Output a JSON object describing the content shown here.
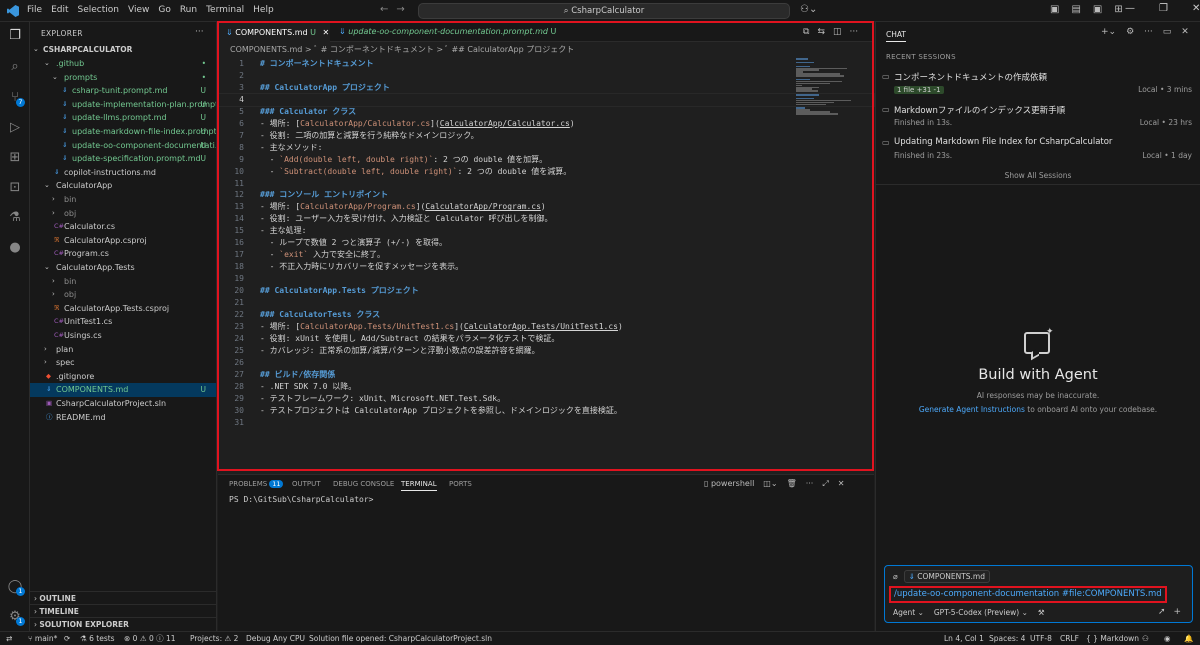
{
  "titlebar": {
    "menu": [
      "File",
      "Edit",
      "Selection",
      "View",
      "Go",
      "Run",
      "Terminal",
      "Help"
    ],
    "search": "CsharpCalculator"
  },
  "activity_badges": {
    "source_control": "7",
    "accounts": "1",
    "settings": "1"
  },
  "explorer": {
    "header": "EXPLORER",
    "root": "CSHARPCALCULATOR",
    "items": [
      {
        "label": ".github",
        "depth": 1,
        "type": "folder-open",
        "status": "•",
        "color": "#73c991"
      },
      {
        "label": "prompts",
        "depth": 2,
        "type": "folder-open",
        "status": "•",
        "color": "#73c991"
      },
      {
        "label": "csharp-tunit.prompt.md",
        "depth": 3,
        "type": "md",
        "status": "U",
        "color": "#73c991"
      },
      {
        "label": "update-implementation-plan.prompt....",
        "depth": 3,
        "type": "md",
        "status": "U",
        "color": "#73c991"
      },
      {
        "label": "update-llms.prompt.md",
        "depth": 3,
        "type": "md",
        "status": "U",
        "color": "#73c991"
      },
      {
        "label": "update-markdown-file-index.prompt....",
        "depth": 3,
        "type": "md",
        "status": "U",
        "color": "#73c991"
      },
      {
        "label": "update-oo-component-documentati...",
        "depth": 3,
        "type": "md",
        "status": "U",
        "color": "#73c991"
      },
      {
        "label": "update-specification.prompt.md",
        "depth": 3,
        "type": "md",
        "status": "U",
        "color": "#73c991"
      },
      {
        "label": "copilot-instructions.md",
        "depth": 2,
        "type": "md",
        "status": "",
        "color": "#cccccc"
      },
      {
        "label": "CalculatorApp",
        "depth": 1,
        "type": "folder-open",
        "status": "",
        "color": "#cccccc"
      },
      {
        "label": "bin",
        "depth": 2,
        "type": "folder",
        "status": "",
        "color": "#8c8c8c"
      },
      {
        "label": "obj",
        "depth": 2,
        "type": "folder",
        "status": "",
        "color": "#8c8c8c"
      },
      {
        "label": "Calculator.cs",
        "depth": 2,
        "type": "cs",
        "status": "",
        "color": "#cccccc"
      },
      {
        "label": "CalculatorApp.csproj",
        "depth": 2,
        "type": "proj",
        "status": "",
        "color": "#cccccc"
      },
      {
        "label": "Program.cs",
        "depth": 2,
        "type": "cs",
        "status": "",
        "color": "#cccccc"
      },
      {
        "label": "CalculatorApp.Tests",
        "depth": 1,
        "type": "folder-open",
        "status": "",
        "color": "#cccccc"
      },
      {
        "label": "bin",
        "depth": 2,
        "type": "folder",
        "status": "",
        "color": "#8c8c8c"
      },
      {
        "label": "obj",
        "depth": 2,
        "type": "folder",
        "status": "",
        "color": "#8c8c8c"
      },
      {
        "label": "CalculatorApp.Tests.csproj",
        "depth": 2,
        "type": "proj",
        "status": "",
        "color": "#cccccc"
      },
      {
        "label": "UnitTest1.cs",
        "depth": 2,
        "type": "cs",
        "status": "",
        "color": "#cccccc"
      },
      {
        "label": "Usings.cs",
        "depth": 2,
        "type": "cs",
        "status": "",
        "color": "#cccccc"
      },
      {
        "label": "plan",
        "depth": 1,
        "type": "folder",
        "status": "",
        "color": "#cccccc"
      },
      {
        "label": "spec",
        "depth": 1,
        "type": "folder",
        "status": "",
        "color": "#cccccc"
      },
      {
        "label": ".gitignore",
        "depth": 1,
        "type": "git",
        "status": "",
        "color": "#cccccc"
      },
      {
        "label": "COMPONENTS.md",
        "depth": 1,
        "type": "md",
        "status": "U",
        "color": "#73c991",
        "selected": true
      },
      {
        "label": "CsharpCalculatorProject.sln",
        "depth": 1,
        "type": "sln",
        "status": "",
        "color": "#cccccc"
      },
      {
        "label": "README.md",
        "depth": 1,
        "type": "md-info",
        "status": "",
        "color": "#cccccc"
      }
    ],
    "panels": [
      "OUTLINE",
      "TIMELINE",
      "SOLUTION EXPLORER"
    ]
  },
  "editor": {
    "tabs": [
      {
        "label": "COMPONENTS.md",
        "status": "U",
        "active": true
      },
      {
        "label": "update-oo-component-documentation.prompt.md",
        "status": "U",
        "active": false
      }
    ],
    "breadcrumb": "COMPONENTS.md  >  ﾞ # コンポーネントドキュメント  >  ﾞ ## CalculatorApp プロジェクト",
    "lines": [
      {
        "n": "1",
        "text": "# コンポーネントドキュメント",
        "kind": "h"
      },
      {
        "n": "2",
        "text": "",
        "kind": "t"
      },
      {
        "n": "3",
        "text": "## CalculatorApp プロジェクト",
        "kind": "h"
      },
      {
        "n": "4",
        "text": "",
        "kind": "t"
      },
      {
        "n": "5",
        "text": "### Calculator クラス",
        "kind": "h"
      },
      {
        "n": "6",
        "text": "- 場所: [CalculatorApp/Calculator.cs](CalculatorApp/Calculator.cs)",
        "kind": "link"
      },
      {
        "n": "7",
        "text": "- 役割: 二項の加算と減算を行う純粋なドメインロジック。",
        "kind": "t"
      },
      {
        "n": "8",
        "text": "- 主なメソッド:",
        "kind": "t"
      },
      {
        "n": "9",
        "text": "  - `Add(double left, double right)`: 2 つの double 値を加算。",
        "kind": "code"
      },
      {
        "n": "10",
        "text": "  - `Subtract(double left, double right)`: 2 つの double 値を減算。",
        "kind": "code"
      },
      {
        "n": "11",
        "text": "",
        "kind": "t"
      },
      {
        "n": "12",
        "text": "### コンソール エントリポイント",
        "kind": "h"
      },
      {
        "n": "13",
        "text": "- 場所: [CalculatorApp/Program.cs](CalculatorApp/Program.cs)",
        "kind": "link"
      },
      {
        "n": "14",
        "text": "- 役割: ユーザー入力を受け付け、入力検証と Calculator 呼び出しを制御。",
        "kind": "t"
      },
      {
        "n": "15",
        "text": "- 主な処理:",
        "kind": "t"
      },
      {
        "n": "16",
        "text": "  - ループで数値 2 つと演算子 (+/-) を取得。",
        "kind": "t"
      },
      {
        "n": "17",
        "text": "  - `exit` 入力で安全に終了。",
        "kind": "code"
      },
      {
        "n": "18",
        "text": "  - 不正入力時にリカバリーを促すメッセージを表示。",
        "kind": "t"
      },
      {
        "n": "19",
        "text": "",
        "kind": "t"
      },
      {
        "n": "20",
        "text": "## CalculatorApp.Tests プロジェクト",
        "kind": "h"
      },
      {
        "n": "21",
        "text": "",
        "kind": "t"
      },
      {
        "n": "22",
        "text": "### CalculatorTests クラス",
        "kind": "h"
      },
      {
        "n": "23",
        "text": "- 場所: [CalculatorApp.Tests/UnitTest1.cs](CalculatorApp.Tests/UnitTest1.cs)",
        "kind": "link"
      },
      {
        "n": "24",
        "text": "- 役割: xUnit を使用し Add/Subtract の結果をパラメータ化テストで検証。",
        "kind": "t"
      },
      {
        "n": "25",
        "text": "- カバレッジ: 正常系の加算/減算パターンと浮動小数点の誤差許容を網羅。",
        "kind": "t"
      },
      {
        "n": "26",
        "text": "",
        "kind": "t"
      },
      {
        "n": "27",
        "text": "## ビルド/依存関係",
        "kind": "h"
      },
      {
        "n": "28",
        "text": "- .NET SDK 7.0 以降。",
        "kind": "t"
      },
      {
        "n": "29",
        "text": "- テストフレームワーク: xUnit、Microsoft.NET.Test.Sdk。",
        "kind": "t"
      },
      {
        "n": "30",
        "text": "- テストプロジェクトは CalculatorApp プロジェクトを参照し、ドメインロジックを直接検証。",
        "kind": "t"
      },
      {
        "n": "31",
        "text": "",
        "kind": "t"
      }
    ]
  },
  "panel": {
    "tabs": [
      "PROBLEMS",
      "OUTPUT",
      "DEBUG CONSOLE",
      "TERMINAL",
      "PORTS"
    ],
    "problems_count": "11",
    "terminal_name": "powershell",
    "terminal_text": "PS D:\\GitSub\\CsharpCalculator>"
  },
  "chat": {
    "title": "CHAT",
    "recent_header": "RECENT SESSIONS",
    "sessions": [
      {
        "title": "コンポーネントドキュメントの作成依頼",
        "sub_badge": "1 file +31 -1",
        "sub": "",
        "meta": "Local • 3 mins"
      },
      {
        "title": "Markdownファイルのインデックス更新手順",
        "sub_badge": "",
        "sub": "Finished in 13s.",
        "meta": "Local • 23 hrs"
      },
      {
        "title": "Updating Markdown File Index for CsharpCalculator",
        "sub_badge": "",
        "sub": "Finished in 23s.",
        "meta": "Local • 1 day"
      }
    ],
    "show_all": "Show All Sessions",
    "build_title": "Build with Agent",
    "build_sub": "AI responses may be inaccurate.",
    "build_link": "Generate Agent Instructions",
    "build_link_rest": " to onboard AI onto your codebase.",
    "attachment": "COMPONENTS.md",
    "input_text": "/update-oo-component-documentation #file:COMPONENTS.md",
    "mode": "Agent",
    "model": "GPT-5-Codex (Preview)"
  },
  "status": {
    "branch": "main*",
    "tests": "6 tests",
    "errors": "0",
    "warnings": "0",
    "info": "11",
    "projects": "Projects: ⚠ 2",
    "debug": "Debug Any CPU",
    "solution": "Solution file opened: CsharpCalculatorProject.sln",
    "position": "Ln 4, Col 1",
    "spaces": "Spaces: 4",
    "encoding": "UTF-8",
    "eol": "CRLF",
    "language": "Markdown"
  },
  "colors": {
    "accent": "#0078d4",
    "highlight_box": "#e0131f",
    "heading": "#569cd6",
    "link": "#ce9178",
    "untracked": "#73c991"
  }
}
